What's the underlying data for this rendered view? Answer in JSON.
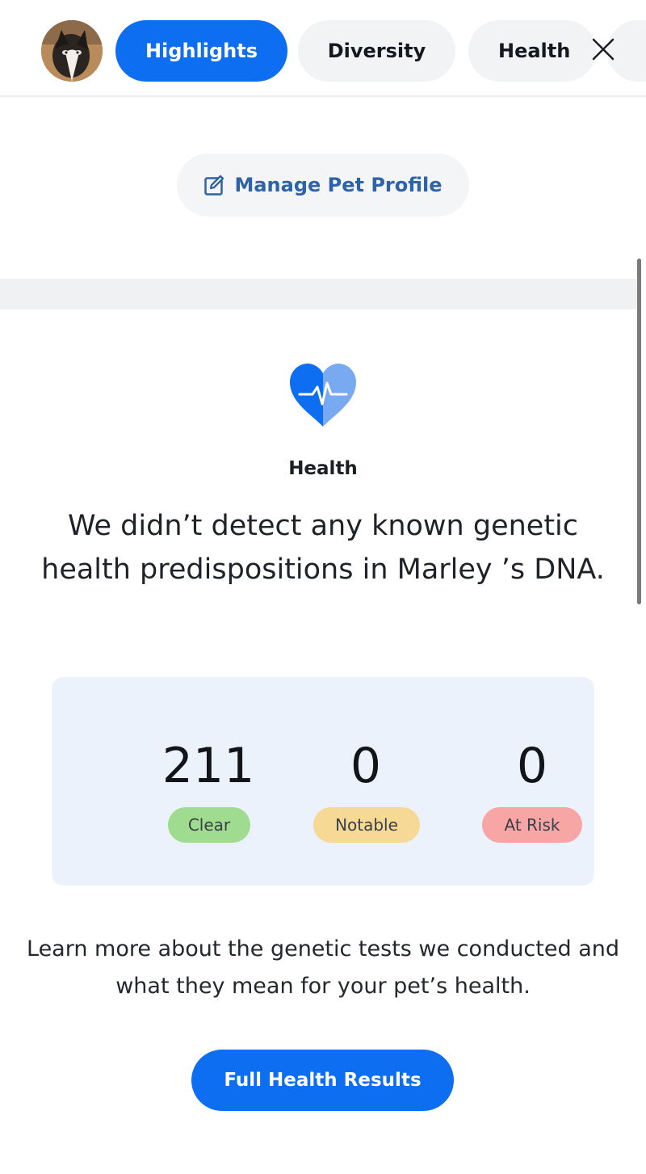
{
  "nav": {
    "tabs": [
      {
        "label": "Highlights",
        "active": true
      },
      {
        "label": "Diversity",
        "active": false
      },
      {
        "label": "Health",
        "active": false
      }
    ],
    "avatar_icon": "dog-photo-avatar",
    "close_icon": "close-icon"
  },
  "profile": {
    "manage_label": "Manage Pet Profile",
    "edit_icon": "edit-icon"
  },
  "health": {
    "icon": "heart-pulse-icon",
    "title": "Health",
    "summary": "We didn’t detect any known genetic health predispositions in Marley ’s DNA.",
    "stats": {
      "clear": {
        "value": "211",
        "label": "Clear",
        "color": "#9fdc8f"
      },
      "notable": {
        "value": "0",
        "label": "Notable",
        "color": "#f5d995"
      },
      "at_risk": {
        "value": "0",
        "label": "At Risk",
        "color": "#f7a5a5"
      }
    },
    "learn_more": "Learn more about the genetic tests we conducted and what they mean for your pet’s health.",
    "cta_label": "Full Health Results"
  },
  "colors": {
    "primary": "#0d6ef2",
    "link": "#2f63a8",
    "card_background": "#ecf2fb"
  }
}
